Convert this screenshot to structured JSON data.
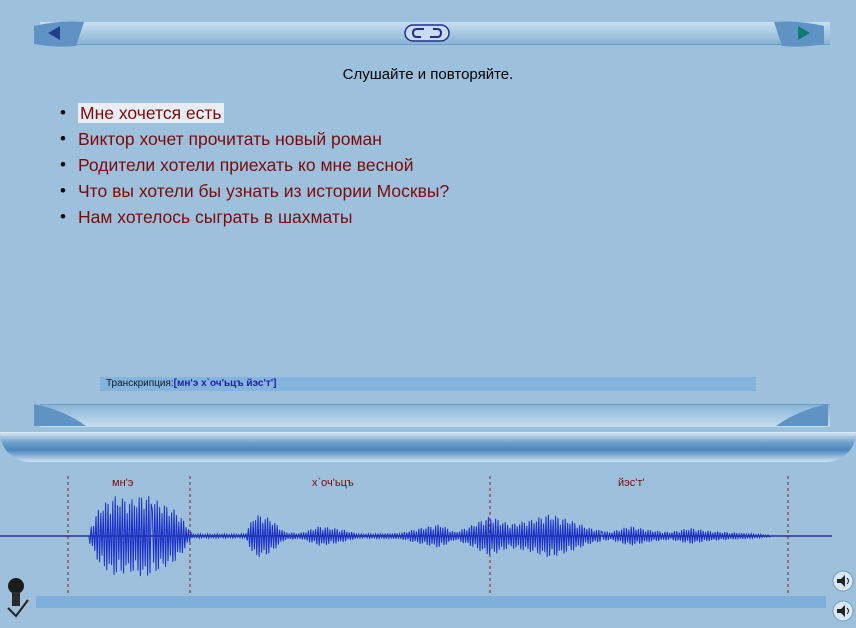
{
  "nav": {
    "back_icon": "arrow-left-icon",
    "forward_icon": "arrow-right-icon",
    "loop_icon": "repeat-icon"
  },
  "instruction": "Слушайте и повторяйте.",
  "sentences": [
    "Мне хочется есть",
    "Виктор хочет прочитать новый роман",
    "Родители хотели приехать ко мне весной",
    "Что вы хотели бы узнать из истории Москвы?",
    "Нам хотелось сыграть в шахматы"
  ],
  "transcription": {
    "label": "Транскрипция:",
    "value": "[мн'э х`оч'ьцъ йэс'т']"
  },
  "waveform": {
    "segments": [
      "мн'э",
      "х`оч'ьцъ",
      "йэс'т'"
    ]
  },
  "colors": {
    "background": "#9dc1dc",
    "sentence_text": "#7b0a0a",
    "waveform": "#1a2fc8",
    "transcription_value": "#1d1fa8"
  }
}
